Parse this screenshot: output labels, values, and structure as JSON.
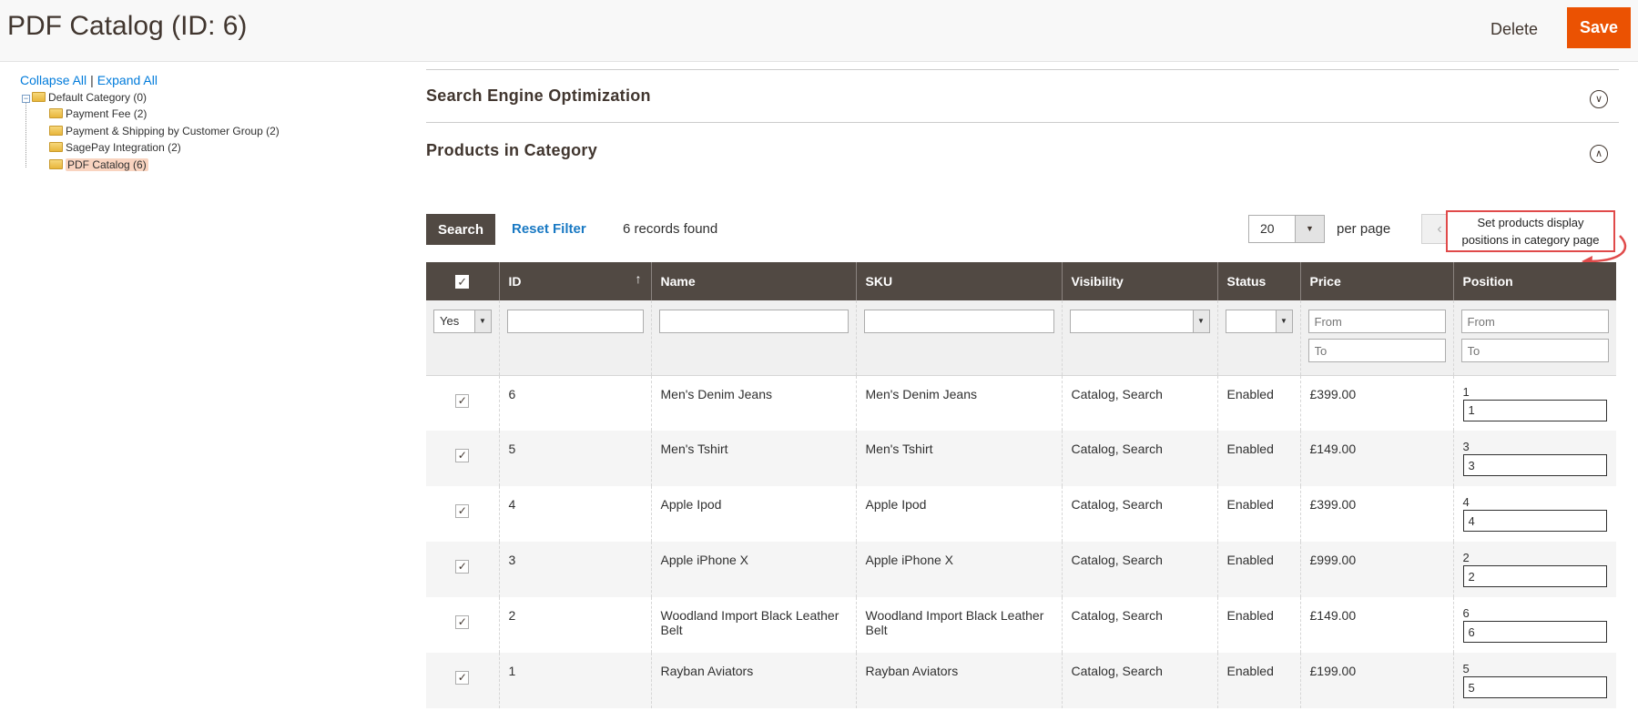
{
  "header": {
    "title": "PDF Catalog (ID: 6)",
    "delete_label": "Delete",
    "save_label": "Save"
  },
  "tree": {
    "collapse_all": "Collapse All",
    "separator": "|",
    "expand_all": "Expand All",
    "root": "Default Category (0)",
    "children": [
      "Payment Fee (2)",
      "Payment & Shipping by Customer Group (2)",
      "SagePay Integration (2)",
      "PDF Catalog (6)"
    ],
    "selected_index": 3
  },
  "sections": {
    "seo_title": "Search Engine Optimization",
    "products_title": "Products in Category"
  },
  "toolbar": {
    "search_label": "Search",
    "reset_label": "Reset Filter",
    "records_found": "6 records found",
    "per_page_value": "20",
    "per_page_label": "per page",
    "prev_icon": "‹"
  },
  "callout": {
    "line1": "Set products display",
    "line2": "positions in category page"
  },
  "grid": {
    "columns": {
      "id": "ID",
      "name": "Name",
      "sku": "SKU",
      "visibility": "Visibility",
      "status": "Status",
      "price": "Price",
      "position": "Position"
    },
    "filters": {
      "in_category": "Yes",
      "price_from": "From",
      "price_to": "To",
      "position_from": "From",
      "position_to": "To"
    },
    "rows": [
      {
        "id": "6",
        "name": "Men's Denim Jeans",
        "sku": "Men's Denim Jeans",
        "visibility": "Catalog, Search",
        "status": "Enabled",
        "price": "£399.00",
        "position": "1",
        "position_input": "1"
      },
      {
        "id": "5",
        "name": "Men's Tshirt",
        "sku": "Men's Tshirt",
        "visibility": "Catalog, Search",
        "status": "Enabled",
        "price": "£149.00",
        "position": "3",
        "position_input": "3"
      },
      {
        "id": "4",
        "name": "Apple Ipod",
        "sku": "Apple Ipod",
        "visibility": "Catalog, Search",
        "status": "Enabled",
        "price": "£399.00",
        "position": "4",
        "position_input": "4"
      },
      {
        "id": "3",
        "name": "Apple iPhone X",
        "sku": "Apple iPhone X",
        "visibility": "Catalog, Search",
        "status": "Enabled",
        "price": "£999.00",
        "position": "2",
        "position_input": "2"
      },
      {
        "id": "2",
        "name": "Woodland Import Black Leather Belt",
        "sku": "Woodland Import Black Leather Belt",
        "visibility": "Catalog, Search",
        "status": "Enabled",
        "price": "£149.00",
        "position": "6",
        "position_input": "6"
      },
      {
        "id": "1",
        "name": "Rayban Aviators",
        "sku": "Rayban Aviators",
        "visibility": "Catalog, Search",
        "status": "Enabled",
        "price": "£199.00",
        "position": "5",
        "position_input": "5"
      }
    ]
  },
  "colors": {
    "accent": "#eb5202",
    "header_dark": "#514943",
    "link": "#007bdb",
    "callout_border": "#e04a4a"
  }
}
